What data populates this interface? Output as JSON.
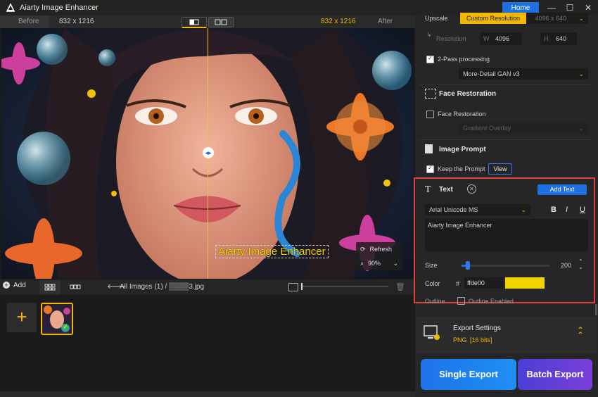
{
  "app": {
    "title": "Aiarty Image Enhancer",
    "home_label": "Home"
  },
  "window": {
    "minimize": "—",
    "maximize": "☐",
    "close": "✕"
  },
  "compare": {
    "before_label": "Before",
    "before_size": "832 x 1216",
    "after_label": "After",
    "after_size": "832 x 1216"
  },
  "viewport": {
    "watermark_text": "Aiarty Image Enhancer",
    "refresh_label": "Refresh",
    "zoom_value": "90%"
  },
  "bottom_toolbar": {
    "add_label": "Add",
    "path_root": "All Images (1)",
    "path_sep": "/",
    "file_name": "▒▒▒▒3.jpg"
  },
  "panel": {
    "upscale_label": "Upscale",
    "upscale_mode": "Custom Resolution",
    "upscale_size": "4096 x 640",
    "resolution_label": "Resolution",
    "width_label": "W",
    "width_value": "4096",
    "height_label": "H",
    "height_value": "640",
    "two_pass_label": "2-Pass processing",
    "two_pass_checked": true,
    "model_value": "More-Detail GAN  v3",
    "face_section": "Face Restoration",
    "face_checkbox_label": "Face Restoration",
    "face_checked": false,
    "face_model_value": "Gradient Overlay",
    "prompt_section": "Image Prompt",
    "keep_prompt_label": "Keep the Prompt",
    "keep_prompt_checked": true,
    "view_label": "View",
    "text_section": "Text",
    "add_text_label": "Add Text",
    "font_value": "Arial Unicode MS",
    "bold_label": "B",
    "italic_label": "I",
    "underline_label": "U",
    "text_content": "Aiarty Image Enhancer",
    "size_label": "Size",
    "size_value": "200",
    "color_label": "Color",
    "color_hash": "#",
    "color_hex": "ffde00",
    "outline_label": "Outline",
    "outline_checkbox_label": "Outline Enabled",
    "outline_checked": false,
    "export_title": "Export Settings",
    "export_format": "PNG",
    "export_bits": "[16 bits]",
    "single_export_label": "Single Export",
    "batch_export_label": "Batch Export"
  },
  "colors": {
    "accent": "#f2b705",
    "primary": "#1e6fe0",
    "highlight": "#e0413d",
    "swatch": "#ffde00"
  }
}
